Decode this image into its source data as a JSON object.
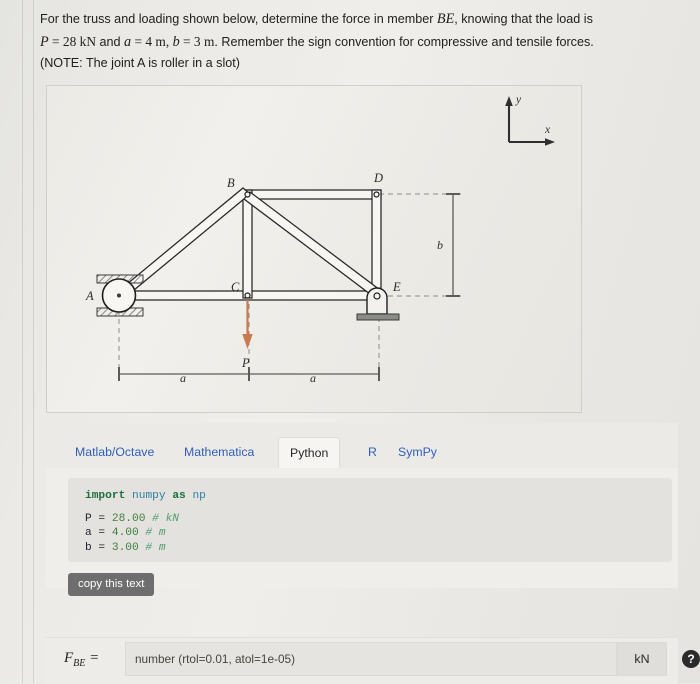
{
  "prompt": {
    "line1_a": "For the truss and loading shown below, determine the force in member ",
    "line1_bm": "BE",
    "line1_b": ", knowing that the load is",
    "line2_p": "P",
    "line2_eq1": " = 28 kN",
    "line2_and": " and ",
    "line2_a": "a",
    "line2_eq2": " = 4 m",
    "line2_comma": ", ",
    "line2_bvar": "b",
    "line2_eq3": " = 3 m",
    "line2_tail": ". Remember the sign convention for compressive and tensile forces.",
    "line3": "(NOTE: The joint A is roller in a slot)"
  },
  "figure": {
    "joints": {
      "A": "A",
      "B": "B",
      "C": "C",
      "D": "D",
      "E": "E"
    },
    "load_label": "P",
    "dim_a_left": "a",
    "dim_a_right": "a",
    "dim_b": "b",
    "axis_x": "x",
    "axis_y": "y",
    "members": [
      "AB",
      "AC",
      "BC",
      "BD",
      "BE",
      "CE",
      "DE"
    ],
    "support_A": "roller-in-slot",
    "support_E": "pin",
    "load_color": "#c97a4e"
  },
  "tabs": {
    "items": [
      {
        "label": "Matlab/Octave",
        "active": false
      },
      {
        "label": "Mathematica",
        "active": false
      },
      {
        "label": "Python",
        "active": true
      },
      {
        "label": "R",
        "active": false
      },
      {
        "label": "SymPy",
        "active": false
      }
    ],
    "link_color": "#2f5fba"
  },
  "code": {
    "l1_kw": "import",
    "l1_mod": "numpy",
    "l1_as": "as",
    "l1_np": "np",
    "l2_var": "P = ",
    "l2_num": "28.00",
    "l2_cmt": " # kN",
    "l3_var": "a = ",
    "l3_num": "4.00",
    "l3_cmt": " # m",
    "l4_var": "b = ",
    "l4_num": "3.00",
    "l4_cmt": " # m"
  },
  "copy_button": {
    "label": "copy this text"
  },
  "answer": {
    "label_f": "F",
    "label_sub": "BE",
    "label_eq": " =",
    "placeholder": "number (rtol=0.01, atol=1e-05)",
    "value": "",
    "unit": "kN",
    "help_glyph": "?"
  }
}
